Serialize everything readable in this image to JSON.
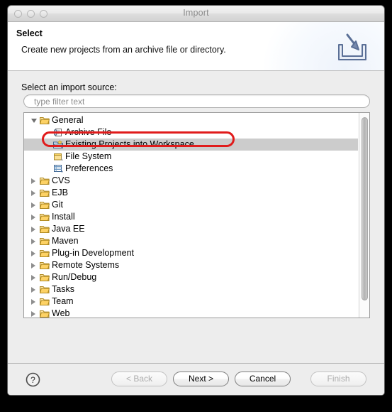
{
  "window": {
    "title": "Import",
    "traffic_lights": [
      "close-button",
      "minimize-button",
      "maximize-button"
    ]
  },
  "header": {
    "title": "Select",
    "description": "Create new projects from an archive file or directory.",
    "icon": "import-wizard-icon"
  },
  "body": {
    "source_label": "Select an import source:",
    "filter": {
      "value": "",
      "placeholder": "type filter text",
      "icon": "filter-text-field"
    }
  },
  "tree": {
    "items": [
      {
        "label": "General",
        "depth": 0,
        "state": "expanded",
        "icon": "folder-open-icon",
        "selected": false
      },
      {
        "label": "Archive File",
        "depth": 1,
        "state": "leaf",
        "icon": "archive-file-icon",
        "selected": false
      },
      {
        "label": "Existing Projects into Workspace",
        "depth": 1,
        "state": "leaf",
        "icon": "projects-import-icon",
        "selected": true
      },
      {
        "label": "File System",
        "depth": 1,
        "state": "leaf",
        "icon": "file-system-icon",
        "selected": false
      },
      {
        "label": "Preferences",
        "depth": 1,
        "state": "leaf",
        "icon": "preferences-icon",
        "selected": false
      },
      {
        "label": "CVS",
        "depth": 0,
        "state": "collapsed",
        "icon": "folder-open-icon",
        "selected": false
      },
      {
        "label": "EJB",
        "depth": 0,
        "state": "collapsed",
        "icon": "folder-open-icon",
        "selected": false
      },
      {
        "label": "Git",
        "depth": 0,
        "state": "collapsed",
        "icon": "folder-open-icon",
        "selected": false
      },
      {
        "label": "Install",
        "depth": 0,
        "state": "collapsed",
        "icon": "folder-open-icon",
        "selected": false
      },
      {
        "label": "Java EE",
        "depth": 0,
        "state": "collapsed",
        "icon": "folder-open-icon",
        "selected": false
      },
      {
        "label": "Maven",
        "depth": 0,
        "state": "collapsed",
        "icon": "folder-open-icon",
        "selected": false
      },
      {
        "label": "Plug-in Development",
        "depth": 0,
        "state": "collapsed",
        "icon": "folder-open-icon",
        "selected": false
      },
      {
        "label": "Remote Systems",
        "depth": 0,
        "state": "collapsed",
        "icon": "folder-open-icon",
        "selected": false
      },
      {
        "label": "Run/Debug",
        "depth": 0,
        "state": "collapsed",
        "icon": "folder-open-icon",
        "selected": false
      },
      {
        "label": "Tasks",
        "depth": 0,
        "state": "collapsed",
        "icon": "folder-open-icon",
        "selected": false
      },
      {
        "label": "Team",
        "depth": 0,
        "state": "collapsed",
        "icon": "folder-open-icon",
        "selected": false
      },
      {
        "label": "Web",
        "depth": 0,
        "state": "collapsed",
        "icon": "folder-open-icon",
        "selected": false
      }
    ],
    "selected_label": "Existing Projects into Workspace",
    "annotation": {
      "shape": "rounded-rectangle",
      "color": "#e01b1b",
      "target": "Existing Projects into Workspace"
    }
  },
  "footer": {
    "help_icon": "help-question-icon",
    "buttons": [
      {
        "label": "< Back",
        "enabled": false
      },
      {
        "label": "Next >",
        "enabled": true
      },
      {
        "label": "Cancel",
        "enabled": true
      },
      {
        "label": "Finish",
        "enabled": false
      }
    ]
  },
  "colors": {
    "annotation_red": "#e01b1b",
    "selection_gray": "#cccccc",
    "window_background": "#ededed",
    "folder_yellow": "#f2c14b"
  }
}
